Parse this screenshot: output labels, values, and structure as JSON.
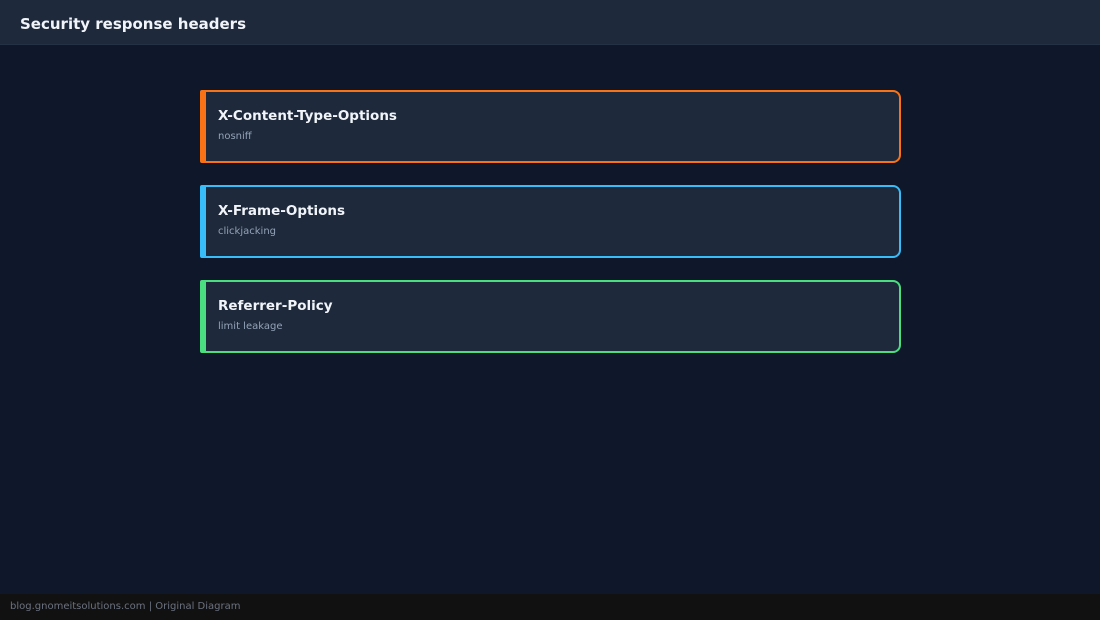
{
  "header": {
    "title": "Security response headers"
  },
  "cards": [
    {
      "title": "X-Content-Type-Options",
      "subtitle": "nosniff",
      "color": "#f97316"
    },
    {
      "title": "X-Frame-Options",
      "subtitle": "clickjacking",
      "color": "#38bdf8"
    },
    {
      "title": "Referrer-Policy",
      "subtitle": "limit leakage",
      "color": "#4ade80"
    }
  ],
  "footer": {
    "text": "blog.gnomeitsolutions.com | Original Diagram"
  }
}
